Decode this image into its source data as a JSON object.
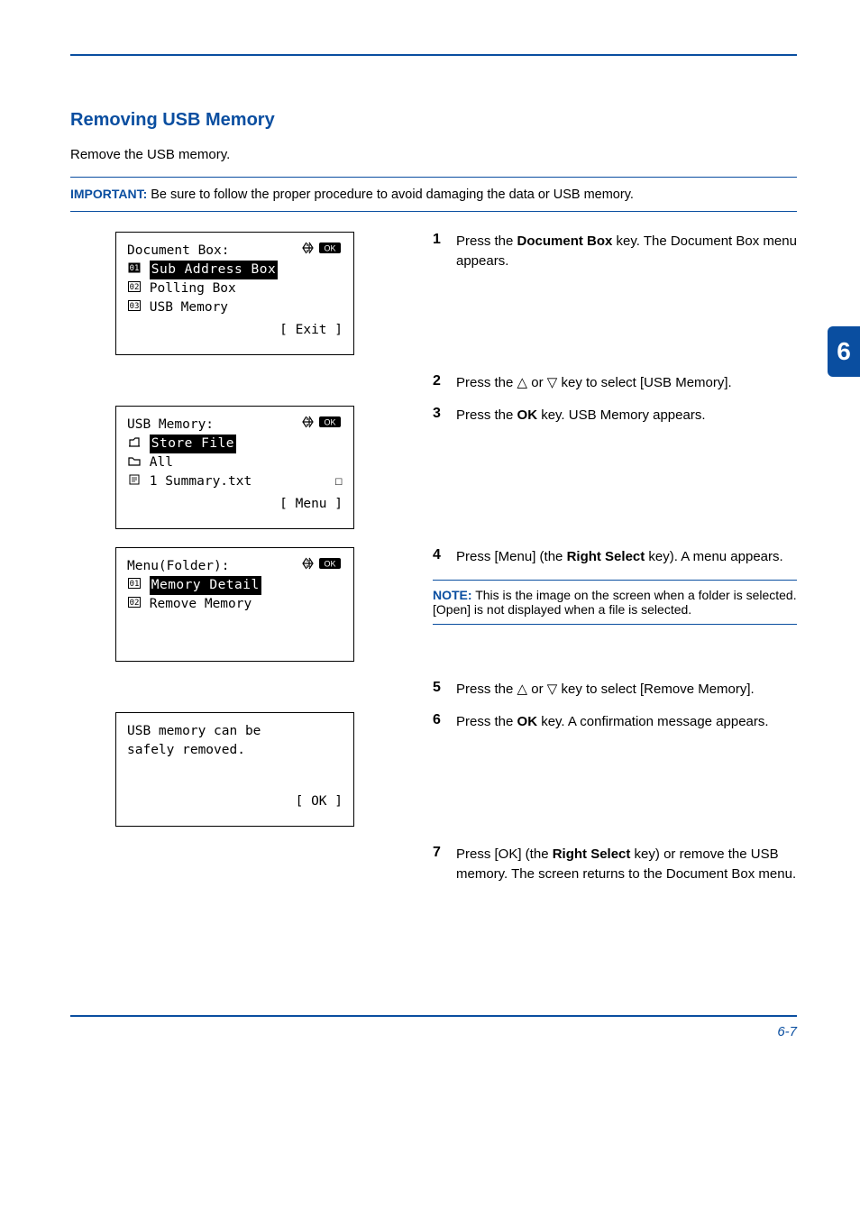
{
  "section_title": "Removing USB Memory",
  "intro": "Remove the USB memory.",
  "important": {
    "label": "IMPORTANT:",
    "text": " Be sure to follow the proper procedure to avoid damaging the data or USB memory."
  },
  "lcd1": {
    "title": "Document Box:",
    "l1_num": "1",
    "l1_text": "Sub Address Box",
    "l2_num": "2",
    "l2_text": "Polling Box",
    "l3_num": "3",
    "l3_text": "USB Memory",
    "exit": "[ Exit  ]"
  },
  "lcd2": {
    "title": "USB Memory:",
    "l1_text": "Store File",
    "l2_text": "All",
    "l3_text": "1  Summary.txt",
    "menu": "[  Menu  ]"
  },
  "lcd3": {
    "title": "Menu(Folder):",
    "l1_num": "1",
    "l1_text": "Memory Detail",
    "l2_num": "2",
    "l2_text": "Remove Memory"
  },
  "lcd4": {
    "l1": "USB memory can be",
    "l2": "safely removed.",
    "ok": "[  OK  ]"
  },
  "steps": {
    "s1_num": "1",
    "s1a": "Press the ",
    "s1b": "Document Box",
    "s1c": " key. The Document Box menu appears.",
    "s2_num": "2",
    "s2a": "Press the ",
    "s2b": " or ",
    "s2c": " key to select [USB Memory].",
    "s3_num": "3",
    "s3a": "Press the ",
    "s3b": "OK",
    "s3c": " key. USB Memory appears.",
    "s4_num": "4",
    "s4a": "Press [Menu] (the ",
    "s4b": "Right Select",
    "s4c": " key). A menu appears.",
    "note_label": "NOTE:",
    "note_text": " This is the image on the screen when a folder is selected. [Open] is not displayed when a file is selected.",
    "s5_num": "5",
    "s5a": "Press the ",
    "s5b": " or ",
    "s5c": " key to select [Remove Memory].",
    "s6_num": "6",
    "s6a": "Press the ",
    "s6b": "OK",
    "s6c": " key. A confirmation message appears.",
    "s7_num": "7",
    "s7a": "Press [OK] (the ",
    "s7b": "Right Select",
    "s7c": " key) or remove the USB memory. The screen returns to the Document Box menu."
  },
  "tab": "6",
  "footer": "6-7"
}
